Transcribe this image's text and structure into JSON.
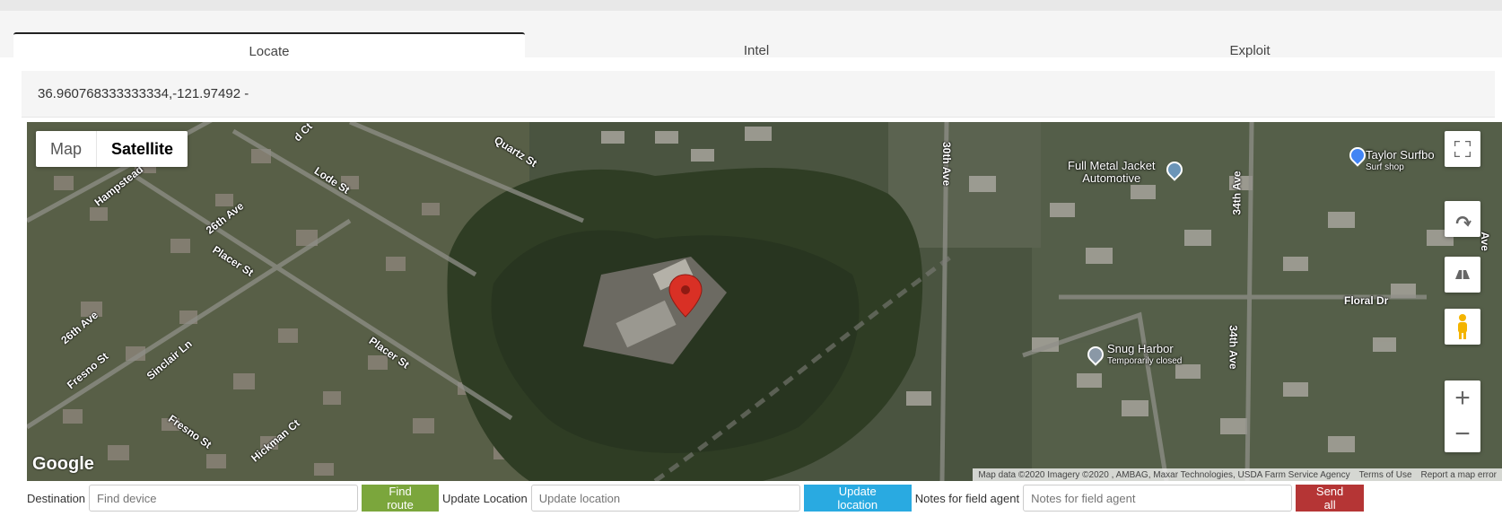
{
  "tabs": [
    {
      "label": "Locate",
      "active": true
    },
    {
      "label": "Intel",
      "active": false
    },
    {
      "label": "Exploit",
      "active": false
    }
  ],
  "coordinates": "36.960768333333334,-121.97492 -",
  "map": {
    "type_buttons": {
      "map": "Map",
      "satellite": "Satellite",
      "selected": "Satellite"
    },
    "road_labels": {
      "quartz_st": "Quartz St",
      "lode_st": "Lode St",
      "hampstead": "Hampstead",
      "ave_26th_top": "26th Ave",
      "placer_st_top": "Placer St",
      "ave_26th_bottom": "26th Ave",
      "fresno_st_left": "Fresno St",
      "sinclair_ln": "Sinclair Ln",
      "placer_st_bottom": "Placer St",
      "fresno_st_bottom": "Fresno St",
      "hickman_ct": "Hickman Ct",
      "ave_30th": "30th Ave",
      "ave_34th_top": "34th Ave",
      "ave_34th_bottom": "34th Ave",
      "floral_dr": "Floral Dr",
      "ave_edge": "Ave",
      "ct_top": "d Ct"
    },
    "pois": {
      "full_metal_jacket": "Full Metal Jacket",
      "full_metal_jacket_sub": "Automotive",
      "taylor_surf": "Taylor Surfbo",
      "taylor_surf_sub": "Surf shop",
      "snug_harbor": "Snug Harbor",
      "snug_harbor_sub": "Temporarily closed"
    },
    "logo": "Google",
    "attribution": {
      "data": "Map data ©2020 Imagery ©2020 , AMBAG, Maxar Technologies, USDA Farm Service Agency",
      "terms": "Terms of Use",
      "report": "Report a map error"
    },
    "marker_color": "#d93025"
  },
  "form": {
    "destination_label": "Destination",
    "destination_placeholder": "Find device",
    "find_route": "Find route",
    "update_location_label": "Update Location",
    "update_location_placeholder": "Update location",
    "update_location_button": "Update location",
    "notes_label": "Notes for field agent",
    "notes_placeholder": "Notes for field agent",
    "send_all": "Send all"
  },
  "colors": {
    "find_route": "#7ba63c",
    "update_location": "#29aae1",
    "send_all": "#b53535"
  }
}
